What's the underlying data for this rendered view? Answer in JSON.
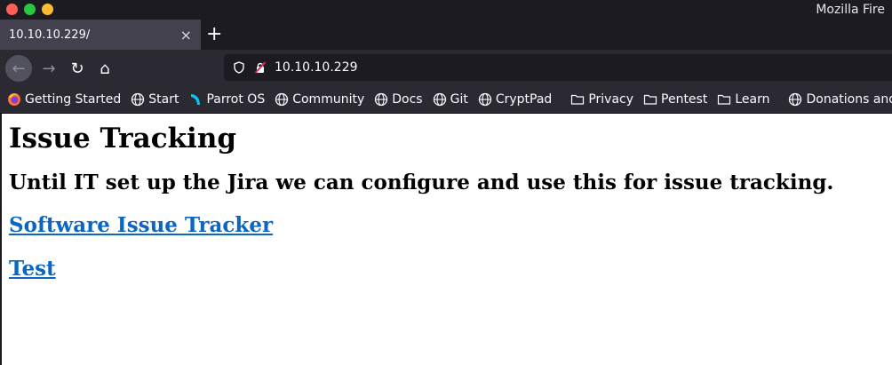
{
  "window": {
    "title": "Mozilla Fire"
  },
  "tab": {
    "label": "10.10.10.229/",
    "close_glyph": "×",
    "new_tab_glyph": "+"
  },
  "nav": {
    "back_glyph": "←",
    "forward_glyph": "→",
    "reload_glyph": "↻",
    "home_glyph": "⌂",
    "url": "10.10.10.229"
  },
  "bookmarks": [
    {
      "label": "Getting Started",
      "icon": "firefox-icon"
    },
    {
      "label": "Start",
      "icon": "globe-icon"
    },
    {
      "label": "Parrot OS",
      "icon": "parrot-icon"
    },
    {
      "label": "Community",
      "icon": "globe-icon"
    },
    {
      "label": "Docs",
      "icon": "globe-icon"
    },
    {
      "label": "Git",
      "icon": "globe-icon"
    },
    {
      "label": "CryptPad",
      "icon": "globe-icon"
    },
    {
      "label": "Privacy",
      "icon": "folder-icon"
    },
    {
      "label": "Pentest",
      "icon": "folder-icon"
    },
    {
      "label": "Learn",
      "icon": "folder-icon"
    },
    {
      "label": "Donations and Ga",
      "icon": "globe-icon"
    }
  ],
  "page": {
    "heading": "Issue Tracking",
    "subheading": "Until IT set up the Jira we can configure and use this for issue tracking.",
    "links": [
      {
        "label": "Software Issue Tracker"
      },
      {
        "label": "Test"
      }
    ]
  },
  "colors": {
    "link": "#0a66c2",
    "chrome_bg": "#2b2a33",
    "tabstrip_bg": "#1c1b22"
  }
}
